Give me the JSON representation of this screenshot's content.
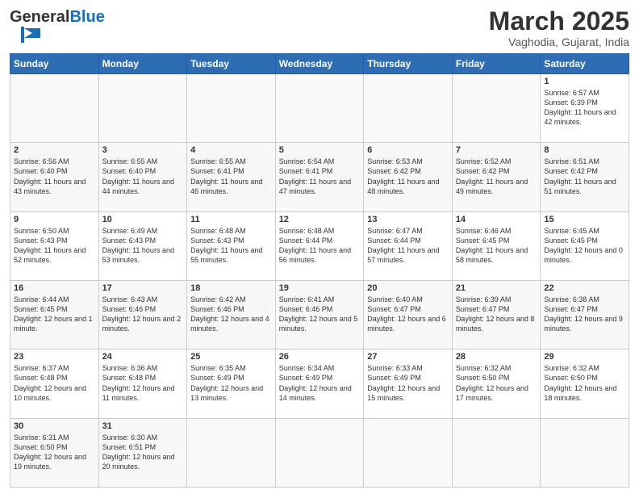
{
  "header": {
    "logo_general": "General",
    "logo_blue": "Blue",
    "month": "March 2025",
    "location": "Vaghodia, Gujarat, India"
  },
  "weekdays": [
    "Sunday",
    "Monday",
    "Tuesday",
    "Wednesday",
    "Thursday",
    "Friday",
    "Saturday"
  ],
  "rows": [
    [
      {
        "day": "",
        "info": ""
      },
      {
        "day": "",
        "info": ""
      },
      {
        "day": "",
        "info": ""
      },
      {
        "day": "",
        "info": ""
      },
      {
        "day": "",
        "info": ""
      },
      {
        "day": "",
        "info": ""
      },
      {
        "day": "1",
        "info": "Sunrise: 6:57 AM\nSunset: 6:39 PM\nDaylight: 11 hours and 42 minutes."
      }
    ],
    [
      {
        "day": "2",
        "info": "Sunrise: 6:56 AM\nSunset: 6:40 PM\nDaylight: 11 hours and 43 minutes."
      },
      {
        "day": "3",
        "info": "Sunrise: 6:55 AM\nSunset: 6:40 PM\nDaylight: 11 hours and 44 minutes."
      },
      {
        "day": "4",
        "info": "Sunrise: 6:55 AM\nSunset: 6:41 PM\nDaylight: 11 hours and 46 minutes."
      },
      {
        "day": "5",
        "info": "Sunrise: 6:54 AM\nSunset: 6:41 PM\nDaylight: 11 hours and 47 minutes."
      },
      {
        "day": "6",
        "info": "Sunrise: 6:53 AM\nSunset: 6:42 PM\nDaylight: 11 hours and 48 minutes."
      },
      {
        "day": "7",
        "info": "Sunrise: 6:52 AM\nSunset: 6:42 PM\nDaylight: 11 hours and 49 minutes."
      },
      {
        "day": "8",
        "info": "Sunrise: 6:51 AM\nSunset: 6:42 PM\nDaylight: 11 hours and 51 minutes."
      }
    ],
    [
      {
        "day": "9",
        "info": "Sunrise: 6:50 AM\nSunset: 6:43 PM\nDaylight: 11 hours and 52 minutes."
      },
      {
        "day": "10",
        "info": "Sunrise: 6:49 AM\nSunset: 6:43 PM\nDaylight: 11 hours and 53 minutes."
      },
      {
        "day": "11",
        "info": "Sunrise: 6:48 AM\nSunset: 6:43 PM\nDaylight: 11 hours and 55 minutes."
      },
      {
        "day": "12",
        "info": "Sunrise: 6:48 AM\nSunset: 6:44 PM\nDaylight: 11 hours and 56 minutes."
      },
      {
        "day": "13",
        "info": "Sunrise: 6:47 AM\nSunset: 6:44 PM\nDaylight: 11 hours and 57 minutes."
      },
      {
        "day": "14",
        "info": "Sunrise: 6:46 AM\nSunset: 6:45 PM\nDaylight: 11 hours and 58 minutes."
      },
      {
        "day": "15",
        "info": "Sunrise: 6:45 AM\nSunset: 6:45 PM\nDaylight: 12 hours and 0 minutes."
      }
    ],
    [
      {
        "day": "16",
        "info": "Sunrise: 6:44 AM\nSunset: 6:45 PM\nDaylight: 12 hours and 1 minute."
      },
      {
        "day": "17",
        "info": "Sunrise: 6:43 AM\nSunset: 6:46 PM\nDaylight: 12 hours and 2 minutes."
      },
      {
        "day": "18",
        "info": "Sunrise: 6:42 AM\nSunset: 6:46 PM\nDaylight: 12 hours and 4 minutes."
      },
      {
        "day": "19",
        "info": "Sunrise: 6:41 AM\nSunset: 6:46 PM\nDaylight: 12 hours and 5 minutes."
      },
      {
        "day": "20",
        "info": "Sunrise: 6:40 AM\nSunset: 6:47 PM\nDaylight: 12 hours and 6 minutes."
      },
      {
        "day": "21",
        "info": "Sunrise: 6:39 AM\nSunset: 6:47 PM\nDaylight: 12 hours and 8 minutes."
      },
      {
        "day": "22",
        "info": "Sunrise: 6:38 AM\nSunset: 6:47 PM\nDaylight: 12 hours and 9 minutes."
      }
    ],
    [
      {
        "day": "23",
        "info": "Sunrise: 6:37 AM\nSunset: 6:48 PM\nDaylight: 12 hours and 10 minutes."
      },
      {
        "day": "24",
        "info": "Sunrise: 6:36 AM\nSunset: 6:48 PM\nDaylight: 12 hours and 11 minutes."
      },
      {
        "day": "25",
        "info": "Sunrise: 6:35 AM\nSunset: 6:49 PM\nDaylight: 12 hours and 13 minutes."
      },
      {
        "day": "26",
        "info": "Sunrise: 6:34 AM\nSunset: 6:49 PM\nDaylight: 12 hours and 14 minutes."
      },
      {
        "day": "27",
        "info": "Sunrise: 6:33 AM\nSunset: 6:49 PM\nDaylight: 12 hours and 15 minutes."
      },
      {
        "day": "28",
        "info": "Sunrise: 6:32 AM\nSunset: 6:50 PM\nDaylight: 12 hours and 17 minutes."
      },
      {
        "day": "29",
        "info": "Sunrise: 6:32 AM\nSunset: 6:50 PM\nDaylight: 12 hours and 18 minutes."
      }
    ],
    [
      {
        "day": "30",
        "info": "Sunrise: 6:31 AM\nSunset: 6:50 PM\nDaylight: 12 hours and 19 minutes."
      },
      {
        "day": "31",
        "info": "Sunrise: 6:30 AM\nSunset: 6:51 PM\nDaylight: 12 hours and 20 minutes."
      },
      {
        "day": "",
        "info": ""
      },
      {
        "day": "",
        "info": ""
      },
      {
        "day": "",
        "info": ""
      },
      {
        "day": "",
        "info": ""
      },
      {
        "day": "",
        "info": ""
      }
    ]
  ]
}
